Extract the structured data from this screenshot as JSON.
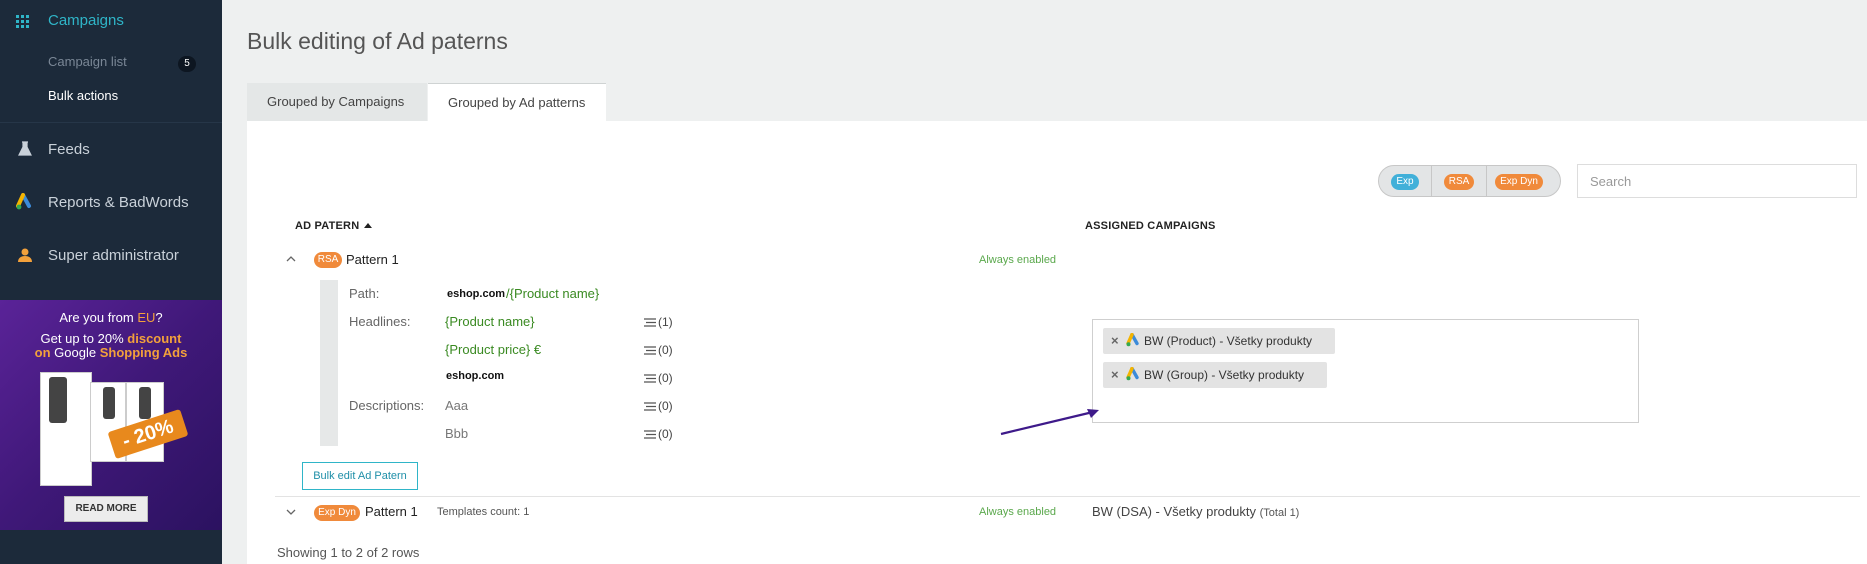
{
  "sidebar": {
    "campaigns_label": "Campaigns",
    "campaign_list_label": "Campaign list",
    "campaign_list_count": "5",
    "bulk_actions_label": "Bulk actions",
    "feeds_label": "Feeds",
    "reports_label": "Reports & BadWords",
    "admin_label": "Super administrator"
  },
  "promo": {
    "line1_pre": "Are you from ",
    "line1_eu": "EU",
    "line1_post": "?",
    "line2_pre": "Get up to 20% ",
    "line2_hl": "discount",
    "line3_pre": "on",
    "line3_mid": " Google ",
    "line3_hl": "Shopping Ads",
    "discount_badge": "- 20%",
    "read_more": "READ MORE"
  },
  "page": {
    "title": "Bulk editing of Ad paterns",
    "tabs": [
      {
        "label": "Grouped by Campaigns",
        "active": false
      },
      {
        "label": "Grouped by Ad patterns",
        "active": true
      }
    ]
  },
  "filters": {
    "chips": [
      "Exp",
      "RSA",
      "Exp Dyn"
    ],
    "search_placeholder": "Search"
  },
  "table": {
    "col_pattern": "AD PATERN",
    "col_assigned": "ASSIGNED CAMPAIGNS",
    "rows": [
      {
        "type": "RSA",
        "name": "Pattern 1",
        "status": "Always enabled",
        "expanded": true,
        "path_label": "Path:",
        "path_domain": "eshop.com",
        "path_value": "/{Product name}",
        "headlines_label": "Headlines:",
        "headlines": [
          {
            "text": "{Product name}",
            "count": "(1)"
          },
          {
            "text": "{Product price} €",
            "count": "(0)"
          },
          {
            "text": "eshop.com",
            "count": "(0)"
          }
        ],
        "descriptions_label": "Descriptions:",
        "descriptions": [
          {
            "text": "Aaa",
            "count": "(0)"
          },
          {
            "text": "Bbb",
            "count": "(0)"
          }
        ],
        "bulk_edit_button": "Bulk edit Ad Patern",
        "assigned": [
          "BW (Product) - Všetky produkty",
          "BW (Group) - Všetky produkty"
        ]
      },
      {
        "type": "Exp Dyn",
        "name": "Pattern 1",
        "templates_count": "Templates count: 1",
        "status": "Always enabled",
        "expanded": false,
        "assigned_campaign": "BW (DSA) - Všetky produkty",
        "assigned_total": "(Total 1)"
      }
    ],
    "footer": "Showing 1 to 2 of 2 rows"
  },
  "colors": {
    "sidebar_bg": "#1c2a3a",
    "accent": "#2fb5c8",
    "rsa": "#f08a3b",
    "exp": "#41b0d9",
    "enabled_green": "#5aa84c",
    "arrow": "#3e1a8a"
  }
}
